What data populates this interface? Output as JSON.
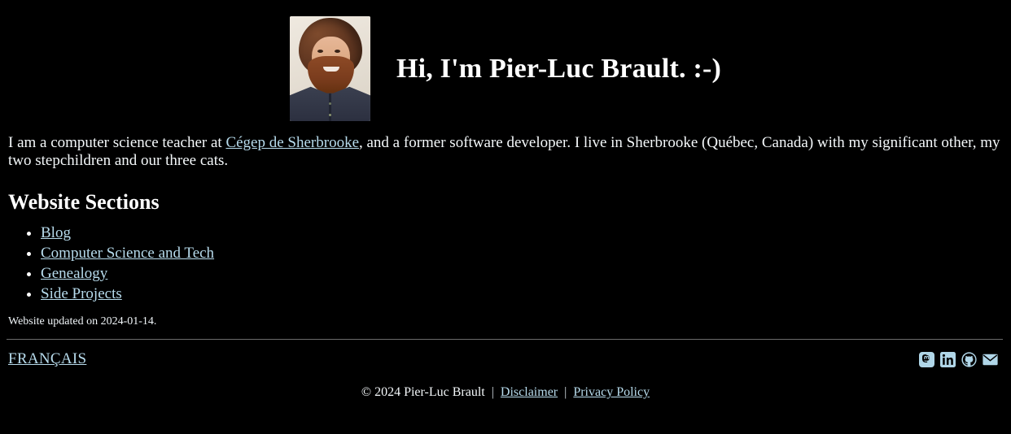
{
  "colors": {
    "background": "#000000",
    "text": "#f4f8fa",
    "link": "#b7dbec",
    "rule": "#6b6b6b",
    "icon": "#b0d6e8"
  },
  "header": {
    "avatar_alt": "Photo of Pier-Luc Brault",
    "title": "Hi, I'm Pier-Luc Brault. :-)"
  },
  "intro": {
    "part1": "I am a computer science teacher at ",
    "link_label": "Cégep de Sherbrooke",
    "part2": ", and a former software developer. I live in Sherbrooke (Québec, Canada) with my significant other, my two stepchildren and our three cats."
  },
  "sections": {
    "heading": "Website Sections",
    "items": [
      {
        "label": "Blog"
      },
      {
        "label": "Computer Science and Tech"
      },
      {
        "label": "Genealogy"
      },
      {
        "label": "Side Projects"
      }
    ]
  },
  "updated": "Website updated on 2024-01-14.",
  "footer": {
    "language_link": "FRANÇAIS",
    "social": [
      {
        "name": "mastodon-icon",
        "label": "Mastodon"
      },
      {
        "name": "linkedin-icon",
        "label": "LinkedIn"
      },
      {
        "name": "github-icon",
        "label": "GitHub"
      },
      {
        "name": "email-icon",
        "label": "Email"
      }
    ],
    "copyright_symbol": "©",
    "copyright_text": "2024 Pier-Luc Brault",
    "separator": "|",
    "disclaimer_label": "Disclaimer",
    "privacy_label": "Privacy Policy"
  }
}
